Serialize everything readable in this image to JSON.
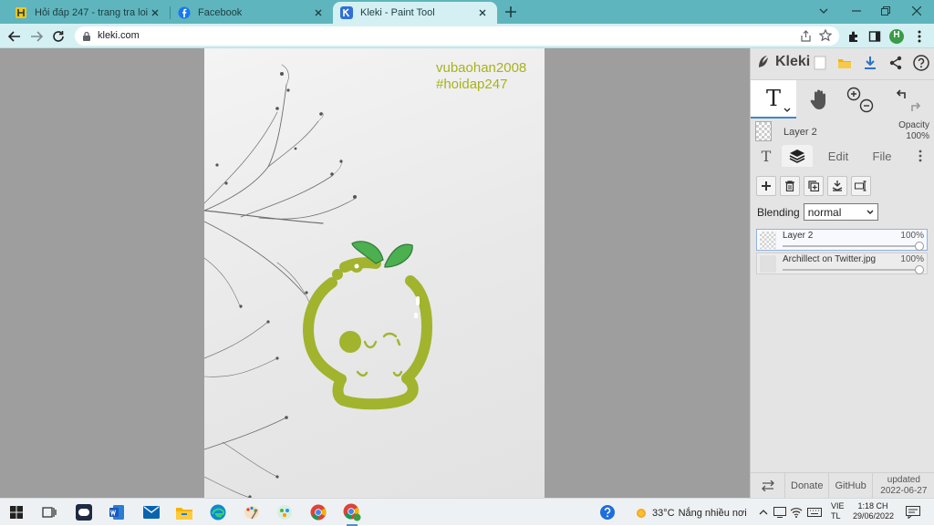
{
  "browser": {
    "tabs": [
      {
        "title": "Hỏi đáp 247 - trang tra loi",
        "favicon": "hoidap-icon",
        "active": false
      },
      {
        "title": "Facebook",
        "favicon": "facebook-icon",
        "active": false
      },
      {
        "title": "Kleki - Paint Tool",
        "favicon": "kleki-icon",
        "active": true
      }
    ],
    "url": "kleki.com",
    "profile_initial": "H",
    "accent": "#5fb5bd"
  },
  "canvas": {
    "watermark_line1": "vubaohan2008",
    "watermark_line2": "#hoidap247",
    "watermark_color": "#a8b21d",
    "stroke_color": "#a2b32e",
    "leaf_color": "#4caf50"
  },
  "panel": {
    "app_name": "Kleki",
    "current_layer": "Layer 2",
    "opacity_label": "Opacity",
    "opacity_value": "100%",
    "tabs": {
      "edit": "Edit",
      "file": "File"
    },
    "blending_label": "Blending",
    "blending_value": "normal",
    "layers": [
      {
        "name": "Layer 2",
        "opacity": "100%",
        "selected": true
      },
      {
        "name": "Archillect on Twitter.jpg",
        "opacity": "100%",
        "selected": false
      }
    ],
    "footer": {
      "donate": "Donate",
      "github": "GitHub",
      "updated_label": "updated",
      "updated_date": "2022-06-27"
    }
  },
  "taskbar": {
    "temperature": "33°C",
    "weather_text": "Nắng nhiều nơi",
    "lang_line1": "VIE",
    "lang_line2": "TL",
    "time": "1:18 CH",
    "date": "29/06/2022"
  }
}
